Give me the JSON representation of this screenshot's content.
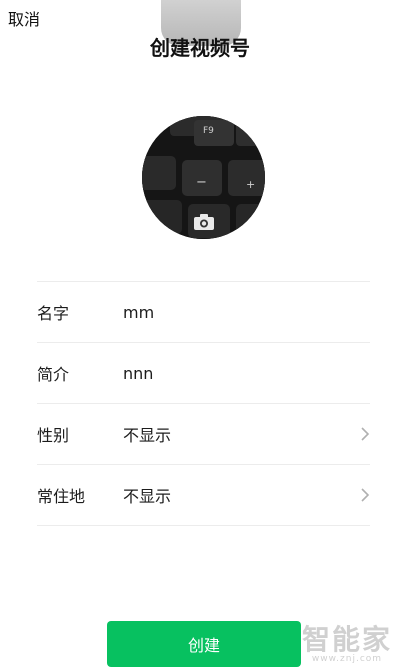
{
  "header": {
    "cancel_label": "取消",
    "title": "创建视频号"
  },
  "avatar": {
    "keycap_label_f9": "F9",
    "keycap_label_minus": "−",
    "keycap_label_plus": "+",
    "camera_icon": "camera-icon"
  },
  "form": {
    "rows": [
      {
        "label": "名字",
        "value": "mm"
      },
      {
        "label": "简介",
        "value": "nnn"
      },
      {
        "label": "性别",
        "value": "不显示"
      },
      {
        "label": "常住地",
        "value": "不显示"
      }
    ]
  },
  "footer": {
    "create_label": "创建"
  },
  "watermark": {
    "title": "智能家",
    "url": "www.znj.com"
  },
  "colors": {
    "accent": "#07c160",
    "divider": "#ececec"
  }
}
